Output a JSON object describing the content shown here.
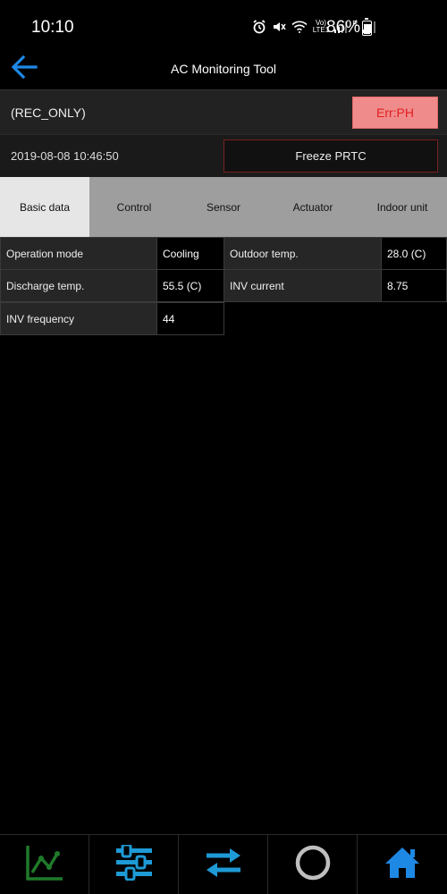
{
  "status_bar": {
    "time": "10:10",
    "battery_percent": "86%",
    "network_label_top": "Vo)",
    "network_label_bottom": "LTE1",
    "roaming_label": "R"
  },
  "app_bar": {
    "title": "AC Monitoring Tool",
    "back_icon": "arrow-left-icon"
  },
  "status_row": {
    "mode_label": "(REC_ONLY)",
    "error_button": "Err:PH"
  },
  "time_row": {
    "timestamp": "2019-08-08 10:46:50",
    "freeze_button": "Freeze PRTC"
  },
  "tabs": [
    {
      "label": "Basic data",
      "active": true
    },
    {
      "label": "Control",
      "active": false
    },
    {
      "label": "Sensor",
      "active": false
    },
    {
      "label": "Actuator",
      "active": false
    },
    {
      "label": "Indoor unit",
      "active": false
    }
  ],
  "basic_data": {
    "operation_mode": {
      "label": "Operation mode",
      "value": "Cooling"
    },
    "outdoor_temp": {
      "label": "Outdoor temp.",
      "value": "28.0 (C)"
    },
    "discharge_temp": {
      "label": "Discharge temp.",
      "value": "55.5 (C)"
    },
    "inv_current": {
      "label": "INV current",
      "value": "8.75"
    },
    "inv_frequency": {
      "label": "INV frequency",
      "value": "44"
    }
  },
  "bottom_nav": [
    {
      "icon": "line-chart-icon",
      "color": "#1f7a2a"
    },
    {
      "icon": "sliders-icon",
      "color": "#1e9ad6"
    },
    {
      "icon": "swap-arrows-icon",
      "color": "#1e9ad6"
    },
    {
      "icon": "circle-icon",
      "color": "#bfbfbf"
    },
    {
      "icon": "home-icon",
      "color": "#1e88e5"
    }
  ],
  "colors": {
    "accent_blue": "#1e88e5",
    "error_text": "#e02020",
    "error_bg": "#f08b8b"
  }
}
